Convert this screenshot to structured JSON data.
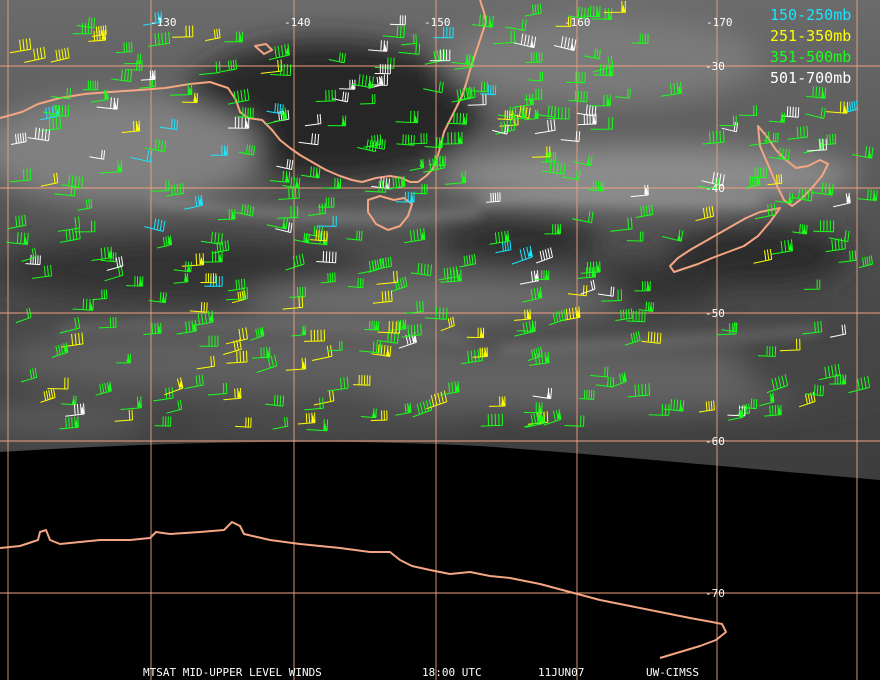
{
  "map": {
    "longitude_labels": [
      "-130",
      "-140",
      "-150",
      "-160",
      "-170"
    ],
    "latitude_labels": [
      "-30",
      "-40",
      "-50",
      "-60",
      "-70"
    ],
    "colors": {
      "grid": "#f0a080",
      "coastline": "#f4a582",
      "background": "#000000"
    }
  },
  "legend": [
    {
      "label": "150-250mb",
      "color": "#19e6ff"
    },
    {
      "label": "251-350mb",
      "color": "#ffff00"
    },
    {
      "label": "351-500mb",
      "color": "#19ff19"
    },
    {
      "label": "501-700mb",
      "color": "#ffffff"
    }
  ],
  "footer": {
    "title": "MTSAT MID-UPPER LEVEL WINDS",
    "time": "18:00 UTC",
    "date": "11JUN07",
    "source": "UW-CIMSS"
  }
}
